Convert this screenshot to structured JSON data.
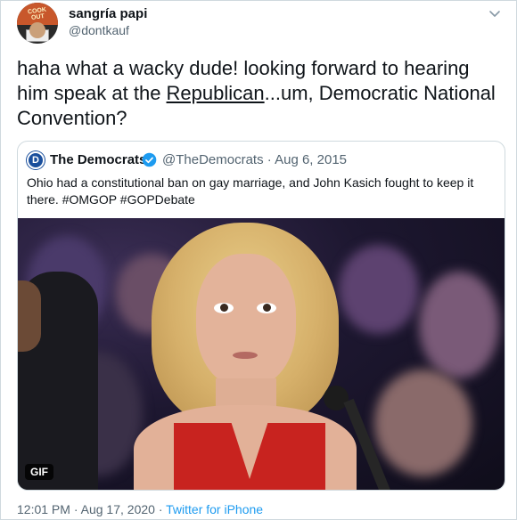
{
  "author": {
    "display_name": "sangría papi",
    "handle": "@dontkauf",
    "avatar_icon": "avatar-cookout-icon",
    "avatar_text": "COOK OUT"
  },
  "tweet": {
    "text_before": "haha what a wacky dude! looking forward to hearing him speak at the ",
    "text_struck": "Republican",
    "text_after": "...um, Democratic National Convention?"
  },
  "quoted": {
    "avatar_letter": "D",
    "display_name": "The Democrats",
    "handle": "@TheDemocrats",
    "separator": "·",
    "date": "Aug 6, 2015",
    "text": "Ohio had a constitutional ban on gay marriage, and John Kasich fought to keep it there. #OMGOP #GOPDebate",
    "media_badge": "GIF",
    "verified_color": "#1d9bf0"
  },
  "footer": {
    "time": "12:01 PM",
    "separator1": "·",
    "date": "Aug 17, 2020",
    "separator2": "·",
    "source": "Twitter for iPhone"
  },
  "colors": {
    "text_primary": "#0f1419",
    "text_secondary": "#536471",
    "link": "#1d9bf0",
    "border": "#cfd9de"
  }
}
